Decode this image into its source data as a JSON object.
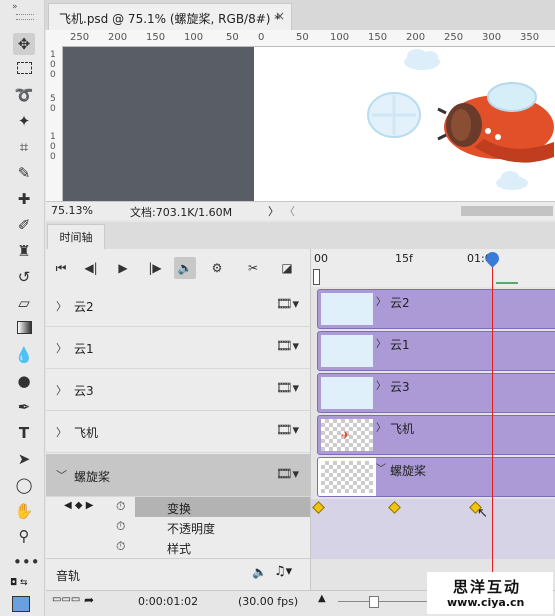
{
  "document_tab": {
    "title": "飞机.psd @ 75.1% (螺旋桨, RGB/8#) *",
    "close": "×"
  },
  "ruler_top": [
    "250",
    "200",
    "150",
    "100",
    "50",
    "0",
    "50",
    "100",
    "150",
    "200",
    "250",
    "300",
    "350"
  ],
  "ruler_left": [
    "1",
    "0",
    "0",
    "5",
    "0",
    "1",
    "0",
    "0"
  ],
  "status": {
    "zoom": "75.13%",
    "doc_info": "文档:703.1K/1.60M",
    "arrow_right": "〉",
    "arrow_left": "〈"
  },
  "timeline": {
    "tab_label": "时间轴",
    "time_ruler": {
      "start": "00",
      "mid": "15f",
      "end": "01:00"
    },
    "layers": [
      {
        "name": "云2",
        "clip": "云2"
      },
      {
        "name": "云1",
        "clip": "云1"
      },
      {
        "name": "云3",
        "clip": "云3"
      },
      {
        "name": "飞机",
        "clip": "飞机"
      },
      {
        "name": "螺旋桨",
        "clip": "螺旋桨"
      }
    ],
    "properties": [
      {
        "name": "变换"
      },
      {
        "name": "不透明度"
      },
      {
        "name": "样式"
      }
    ],
    "audio_track": "音轨",
    "current_time": "0:00:01:02",
    "fps": "(30.00 fps)"
  },
  "watermark": {
    "title": "思洋互动",
    "url": "www.ciya.cn"
  },
  "colors": {
    "clip": "#ab9ad6",
    "playhead": "#e02020",
    "keyframe": "#f1c40f",
    "pasteboard": "#585d66"
  },
  "icons": [
    "move-icon",
    "marquee-icon",
    "lasso-icon",
    "magic-wand-icon",
    "crop-icon",
    "eyedropper-icon",
    "healing-icon",
    "brush-icon",
    "stamp-icon",
    "history-brush-icon",
    "eraser-icon",
    "gradient-icon",
    "blur-icon",
    "dodge-icon",
    "pen-icon",
    "type-icon",
    "path-select-icon",
    "shape-icon",
    "hand-icon",
    "zoom-icon",
    "more-icon"
  ]
}
